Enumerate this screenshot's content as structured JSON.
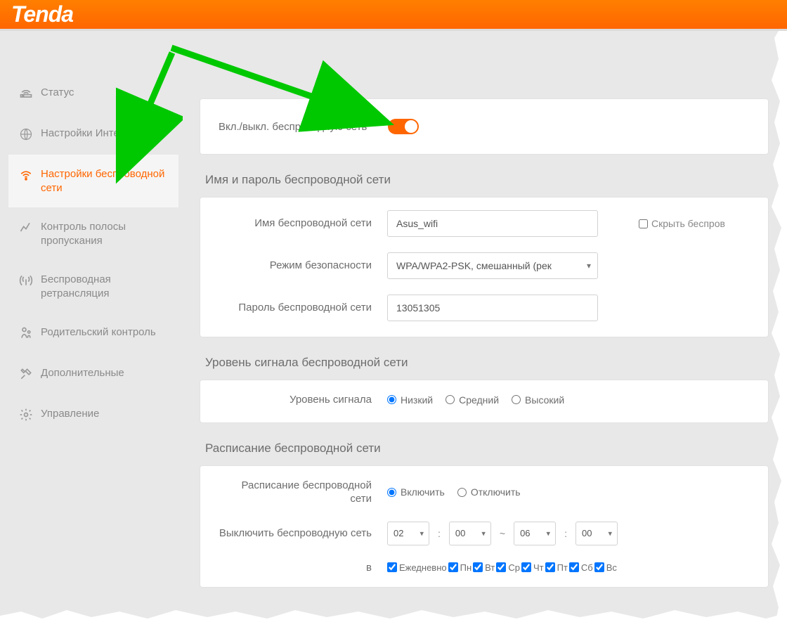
{
  "brand": "Tenda",
  "sidebar": {
    "items": [
      {
        "label": "Статус",
        "icon": "status"
      },
      {
        "label": "Настройки Интернета",
        "icon": "internet"
      },
      {
        "label": "Настройки беспроводной сети",
        "icon": "wifi",
        "active": true
      },
      {
        "label": "Контроль полосы пропускания",
        "icon": "bandwidth"
      },
      {
        "label": "Беспроводная ретрансляция",
        "icon": "relay"
      },
      {
        "label": "Родительский контроль",
        "icon": "parental"
      },
      {
        "label": "Дополнительные",
        "icon": "tools"
      },
      {
        "label": "Управление",
        "icon": "manage"
      }
    ]
  },
  "toggle": {
    "label": "Вкл./выкл. беспроводную сеть",
    "on": true
  },
  "sections": {
    "name_password": {
      "title": "Имя и пароль беспроводной сети",
      "ssid_label": "Имя беспроводной сети",
      "ssid_value": "Asus_wifi",
      "hide_label": "Скрыть беспров",
      "security_label": "Режим безопасности",
      "security_value": "WPA/WPA2-PSK, смешанный (рек",
      "password_label": "Пароль беспроводной сети",
      "password_value": "13051305"
    },
    "signal": {
      "title": "Уровень сигнала беспроводной сети",
      "level_label": "Уровень сигнала",
      "options": {
        "low": "Низкий",
        "mid": "Средний",
        "high": "Высокий"
      },
      "selected": "low"
    },
    "schedule": {
      "title": "Расписание беспроводной сети",
      "schedule_label": "Расписание беспроводной сети",
      "enable": "Включить",
      "disable": "Отключить",
      "off_label": "Выключить беспроводную сеть",
      "from_h": "02",
      "from_m": "00",
      "to_h": "06",
      "to_m": "00",
      "days_prefix": "в",
      "days": {
        "daily": "Ежедневно",
        "mon": "Пн",
        "tue": "Вт",
        "wed": "Ср",
        "thu": "Чт",
        "fri": "Пт",
        "sat": "Сб",
        "sun": "Вс"
      }
    }
  }
}
